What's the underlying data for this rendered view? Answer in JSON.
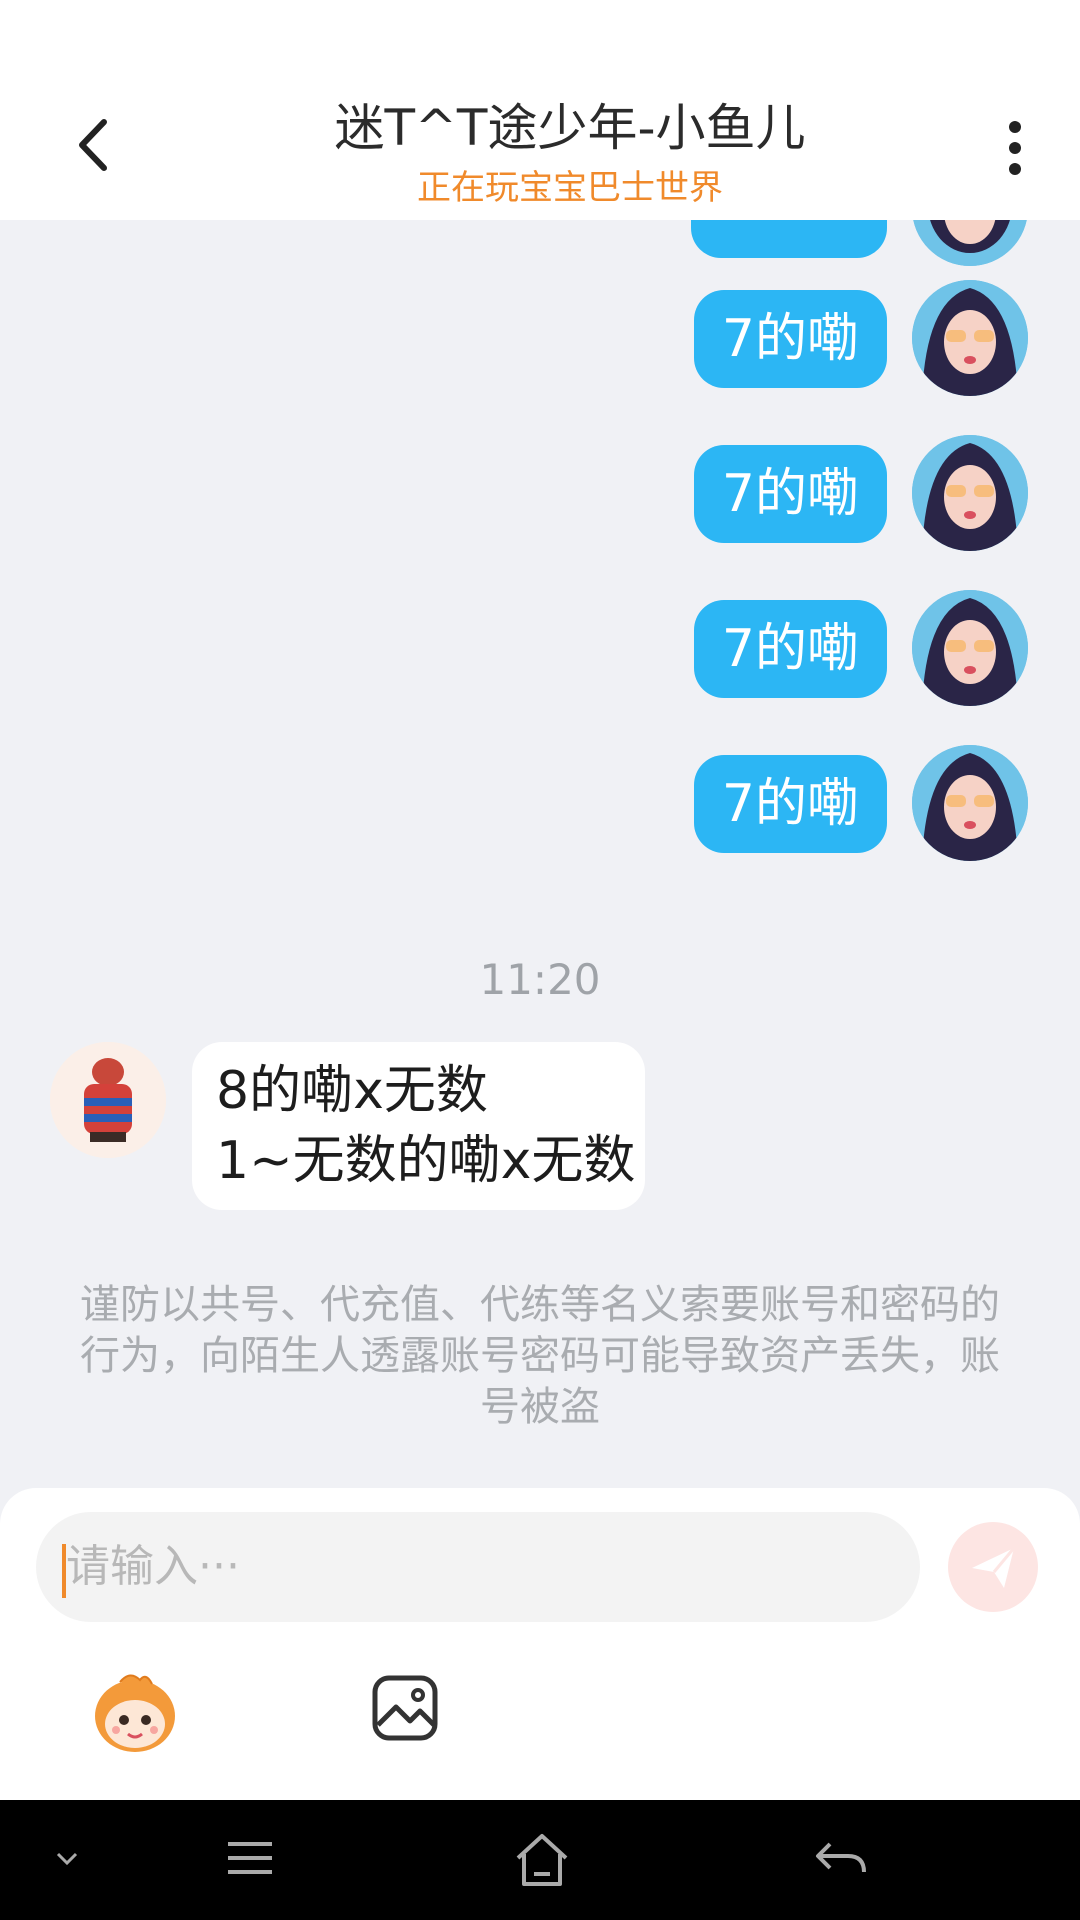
{
  "header": {
    "title": "迷T^T途少年-小鱼儿",
    "status": "正在玩宝宝巴士世界"
  },
  "messages_outgoing": [
    {
      "text": "7的嘞"
    },
    {
      "text": "7的嘞"
    },
    {
      "text": "7的嘞"
    },
    {
      "text": "7的嘞"
    }
  ],
  "timestamp": "11:20",
  "message_incoming": {
    "line1": "8的嘞x无数",
    "line2": "1~无数的嘞x无数"
  },
  "notice": "谨防以共号、代充值、代练等名义索要账号和密码的行为，向陌生人透露账号密码可能导致资产丢失，账号被盗",
  "composer": {
    "placeholder": "请输入···"
  },
  "colors": {
    "accent": "#f08a2b",
    "bubble_out": "#2cb6f4",
    "background": "#f0f1f5"
  }
}
